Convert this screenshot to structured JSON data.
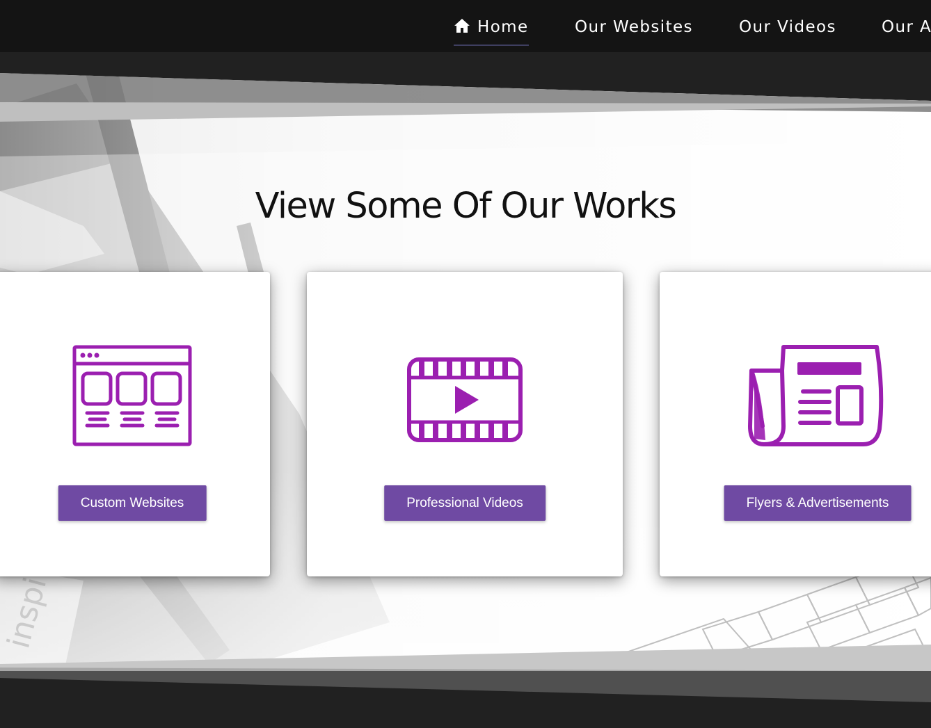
{
  "nav": {
    "items": [
      {
        "label": "Home",
        "icon": "home-icon",
        "active": true
      },
      {
        "label": "Our Websites"
      },
      {
        "label": "Our Videos"
      },
      {
        "label": "Our A"
      }
    ]
  },
  "section": {
    "title": "View Some Of Our Works"
  },
  "cards": [
    {
      "icon": "website-layout-icon",
      "button_label": "Custom Websites"
    },
    {
      "icon": "video-film-icon",
      "button_label": "Professional Videos"
    },
    {
      "icon": "newspaper-icon",
      "button_label": "Flyers & Advertisements"
    }
  ],
  "colors": {
    "accent_purple": "#6f4aa3",
    "icon_purple": "#9b1fb0",
    "navbar": "#141414",
    "dark_band": "#212121"
  }
}
